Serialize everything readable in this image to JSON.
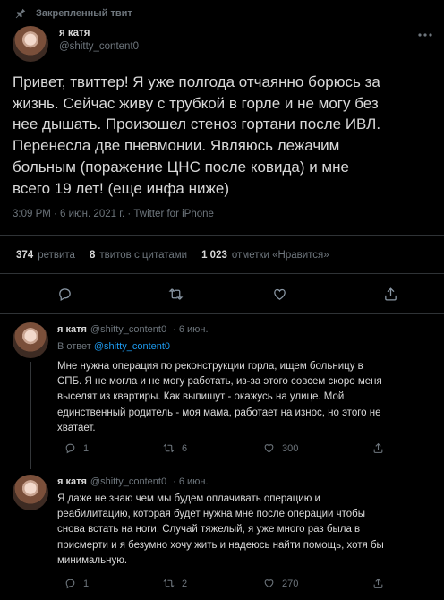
{
  "pinned_label": "Закрепленный твит",
  "main_tweet": {
    "author_name": "я катя",
    "author_handle": "@shitty_content0",
    "text": "Привет, твиттер! Я уже полгода отчаянно борюсь за\nжизнь. Сейчас живу с трубкой в горле и не могу без\nнее дышать. Произошел стеноз гортани после ИВЛ.\nПеренесла две пневмонии. Являюсь лежачим\nбольным (поражение ЦНС после ковида) и мне\nвсего 19 лет! (еще инфа ниже)",
    "meta": "3:09 PM · 6 июн. 2021 г. · Twitter for iPhone",
    "stats": {
      "retweets_count": "374",
      "retweets_label": "ретвита",
      "quotes_count": "8",
      "quotes_label": "твитов с цитатами",
      "likes_count": "1 023",
      "likes_label": "отметки «Нравится»"
    }
  },
  "replies": [
    {
      "author_name": "я катя",
      "author_handle": "@shitty_content0",
      "date": "· 6 июн.",
      "reply_to_prefix": "В ответ",
      "reply_to_mention": "@shitty_content0",
      "text": "Мне нужна операция по реконструкции горла, ищем больницу в\nСПБ. Я не могла и не могу работать, из-за этого совсем скоро меня\nвыселят из квартиры. Как выпишут - окажусь на улице. Мой\nединственный родитель - моя мама, работает на износ, но этого не\nхватает.",
      "reply_count": "1",
      "retweet_count": "6",
      "like_count": "300"
    },
    {
      "author_name": "я катя",
      "author_handle": "@shitty_content0",
      "date": "· 6 июн.",
      "text": "Я даже не знаю чем мы будем оплачивать операцию и\nреабилитацию, которая будет нужна мне после операции чтобы\nснова встать на ноги. Случай тяжелый, я уже много раз была в\nприсмерти и я безумно хочу жить и надеюсь найти помощь, хотя бы\nминимальную.",
      "reply_count": "1",
      "retweet_count": "2",
      "like_count": "270"
    }
  ]
}
